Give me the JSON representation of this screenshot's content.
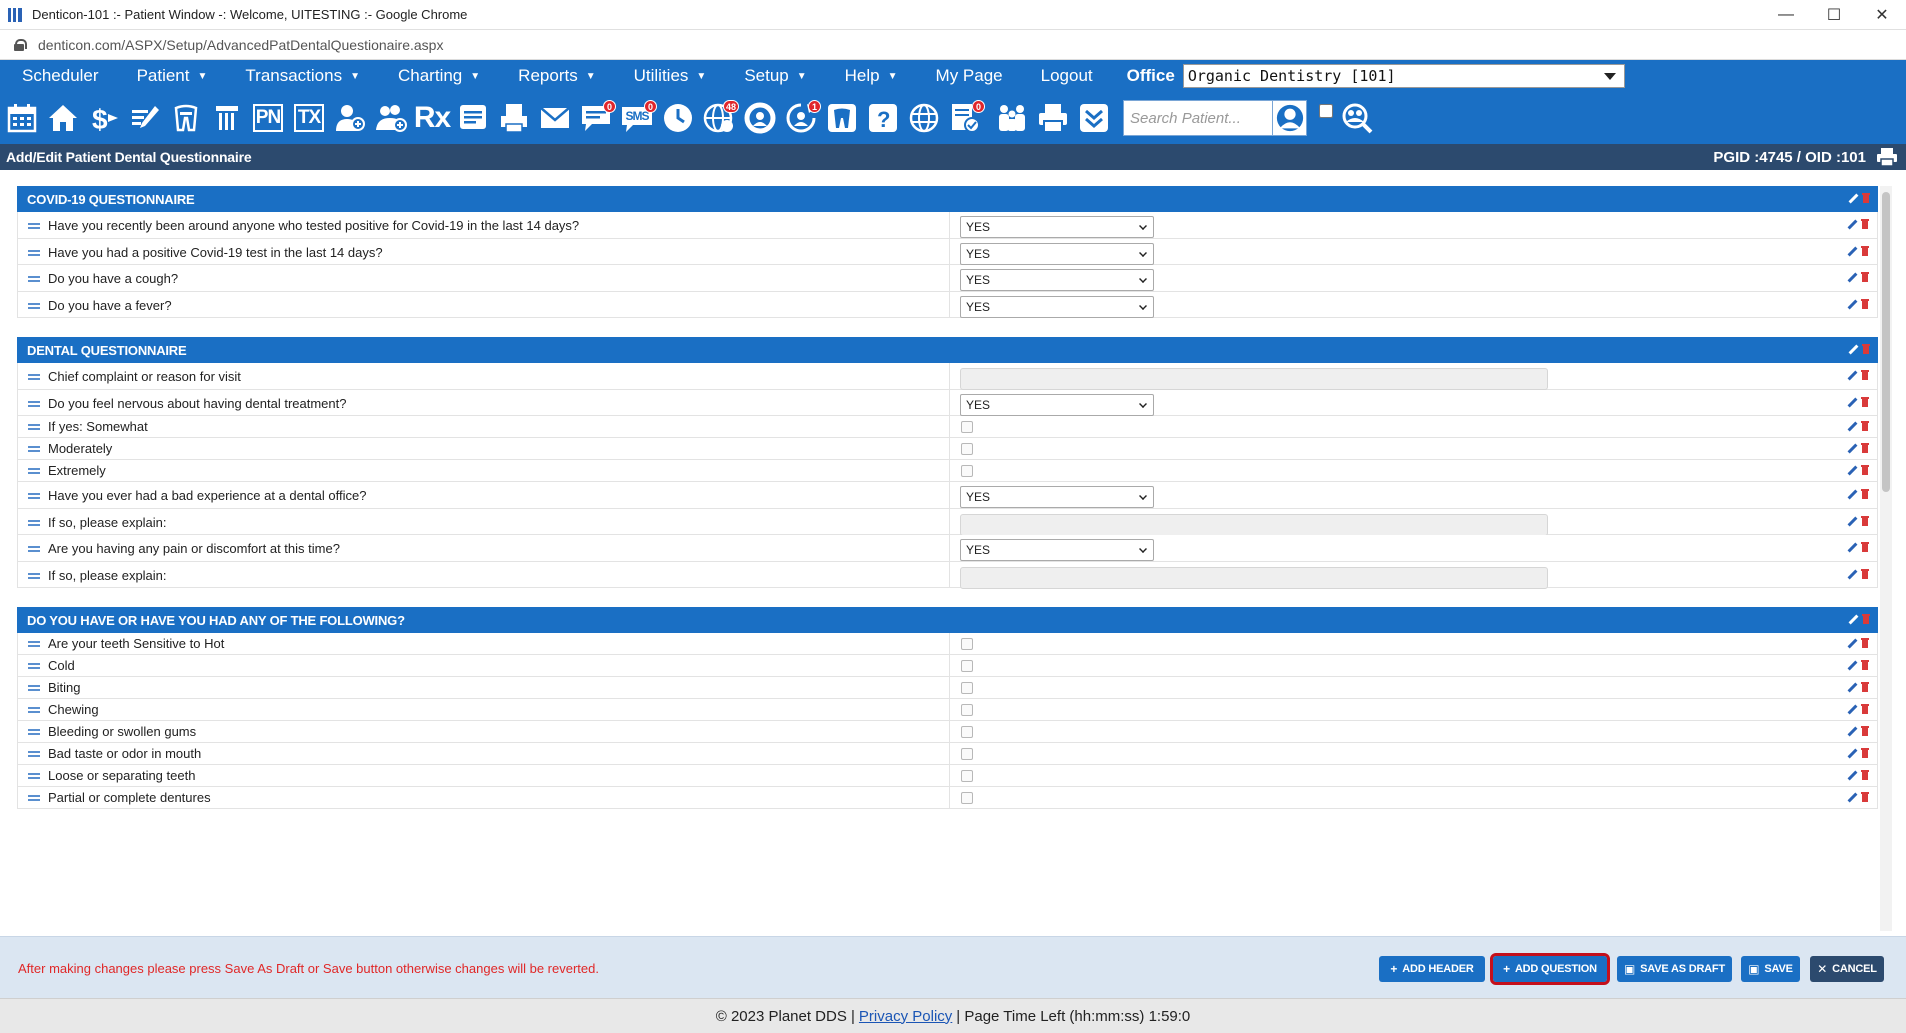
{
  "browser": {
    "window_title": "Denticon-101 :- Patient Window -: Welcome, UITESTING :- Google Chrome",
    "url": "denticon.com/ASPX/Setup/AdvancedPatDentalQuestionaire.aspx",
    "minimize": "—",
    "maximize": "☐",
    "close": "✕"
  },
  "nav": {
    "items": [
      {
        "label": "Scheduler",
        "caret": false
      },
      {
        "label": "Patient",
        "caret": true
      },
      {
        "label": "Transactions",
        "caret": true
      },
      {
        "label": "Charting",
        "caret": true
      },
      {
        "label": "Reports",
        "caret": true
      },
      {
        "label": "Utilities",
        "caret": true
      },
      {
        "label": "Setup",
        "caret": true
      },
      {
        "label": "Help",
        "caret": true
      },
      {
        "label": "My Page",
        "caret": false
      },
      {
        "label": "Logout",
        "caret": false
      }
    ],
    "caret_glyph": "▼",
    "office_label": "Office",
    "office_value": "Organic Dentistry [101]"
  },
  "toolbar": {
    "pn_label": "PN",
    "tx_label": "TX",
    "rx_label": "Rx",
    "sms_label": "SMS",
    "badge_messages": "0",
    "badge_sms": "0",
    "badge_globe": "48",
    "badge_recall": "1",
    "badge_forms": "0",
    "search_placeholder": "Search Patient...",
    "icons": [
      "calendar-icon",
      "home-icon",
      "dollar-icon",
      "edit-icon",
      "tooth-icon",
      "implant-icon",
      "pn-icon",
      "tx-icon",
      "add-patient-icon",
      "add-family-icon",
      "rx-icon",
      "notes-icon",
      "print-doc-icon",
      "mail-icon",
      "message-icon",
      "sms-icon",
      "clock-icon",
      "globe-icon",
      "lifebuoy-icon",
      "recall-icon",
      "tooth-chart-icon",
      "help-tooth-icon",
      "network-icon",
      "forms-icon",
      "family-icon",
      "printer-icon",
      "collapse-icon",
      "search-person-icon",
      "group-search-icon"
    ]
  },
  "page": {
    "title": "Add/Edit Patient Dental Questionnaire",
    "ids": "PGID :4745  /  OID :101"
  },
  "sections": [
    {
      "title": "COVID-19 QUESTIONNAIRE",
      "rows": [
        {
          "q": "Have you recently been around anyone who tested positive for Covid-19 in the last 14 days?",
          "type": "select",
          "value": "YES"
        },
        {
          "q": "Have you had a positive Covid-19 test in the last 14 days?",
          "type": "select",
          "value": "YES"
        },
        {
          "q": "Do you have a cough?",
          "type": "select",
          "value": "YES"
        },
        {
          "q": "Do you have a fever?",
          "type": "select",
          "value": "YES"
        }
      ]
    },
    {
      "title": "DENTAL QUESTIONNAIRE",
      "rows": [
        {
          "q": "Chief complaint or reason for visit",
          "type": "text",
          "value": ""
        },
        {
          "q": "Do you feel nervous about having dental treatment?",
          "type": "select",
          "value": "YES"
        },
        {
          "q": "If yes: Somewhat",
          "type": "check",
          "value": ""
        },
        {
          "q": "Moderately",
          "type": "check",
          "value": ""
        },
        {
          "q": "Extremely",
          "type": "check",
          "value": ""
        },
        {
          "q": "Have you ever had a bad experience at a dental office?",
          "type": "select",
          "value": "YES"
        },
        {
          "q": "If so, please explain:",
          "type": "text",
          "value": ""
        },
        {
          "q": "Are you having any pain or discomfort at this time?",
          "type": "select",
          "value": "YES"
        },
        {
          "q": "If so, please explain:",
          "type": "text",
          "value": ""
        }
      ]
    },
    {
      "title": "DO YOU HAVE OR HAVE YOU HAD ANY OF THE FOLLOWING?",
      "rows": [
        {
          "q": "Are your teeth Sensitive to Hot",
          "type": "check",
          "value": ""
        },
        {
          "q": "Cold",
          "type": "check",
          "value": ""
        },
        {
          "q": "Biting",
          "type": "check",
          "value": ""
        },
        {
          "q": "Chewing",
          "type": "check",
          "value": ""
        },
        {
          "q": "Bleeding or swollen gums",
          "type": "check",
          "value": ""
        },
        {
          "q": "Bad taste or odor in mouth",
          "type": "check",
          "value": ""
        },
        {
          "q": "Loose or separating teeth",
          "type": "check",
          "value": ""
        },
        {
          "q": "Partial or complete dentures",
          "type": "check",
          "value": ""
        }
      ]
    }
  ],
  "footer": {
    "warning": "After making changes please press Save As Draft or Save button otherwise changes will be reverted.",
    "buttons": {
      "add_header": "ADD HEADER",
      "add_question": "ADD QUESTION",
      "save_as_draft": "SAVE AS DRAFT",
      "save": "SAVE",
      "cancel": "CANCEL"
    },
    "highlight_color": "#c4101c"
  },
  "status": {
    "copyright": "© 2023 Planet DDS |",
    "privacy": "Privacy Policy",
    "page_time": "|  Page Time Left (hh:mm:ss) 1:59:0"
  },
  "colors": {
    "brand_blue": "#1a6fc4",
    "header_navy": "#2c4a6e",
    "warning_red": "#e02828"
  }
}
